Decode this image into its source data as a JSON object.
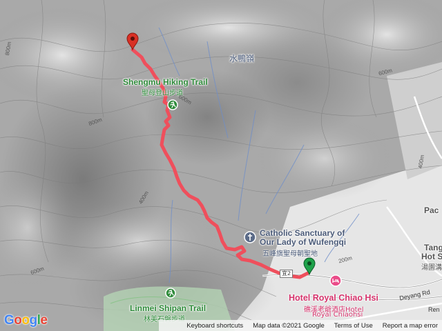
{
  "map": {
    "labels": {
      "shuiyaling": "水鴨嶺",
      "trail_start_en": "Shengmu Hiking Trail",
      "trail_start_zh": "聖母登山步道",
      "sanctuary_en_1": "Catholic Sanctuary of",
      "sanctuary_en_2": "Our Lady of Wufengqi",
      "sanctuary_zh": "五峰旗聖母朝聖地",
      "hotel_en": "Hotel Royal Chiao Hsi",
      "hotel_zh": "礁溪老爺酒店Hotel",
      "hotel_en_2": "Royal Chiaohsi",
      "linmei_en": "Linmei Shipan Trail",
      "linmei_zh": "林美石磐步道",
      "pac": "Pac",
      "tang": "Tang",
      "hot_s": "Hot S",
      "tang_zh": "湯園溝",
      "deyang": "Deyang Rd",
      "ren": "Ren",
      "route_shield": "宜2"
    },
    "contours": {
      "c800a": "800m",
      "c800b": "800m",
      "c600a": "600m",
      "c600b": "600m",
      "c400a": "400m",
      "c400b": "400m",
      "c200a": "200m",
      "c600c": "600m"
    },
    "colors": {
      "route": "#ef4f5c",
      "start_pin": "#1ea24a",
      "end_pin": "#d93025",
      "trail_icon": "#2e8b3a"
    },
    "icons": {
      "end_marker": "red-map-pin-icon",
      "start_marker": "green-map-pin-icon",
      "trailhead": "hiking-icon",
      "church": "church-icon",
      "hotel": "hotel-bed-icon"
    }
  },
  "footer": {
    "logo": [
      "G",
      "o",
      "o",
      "g",
      "l",
      "e"
    ],
    "keyboard": "Keyboard shortcuts",
    "mapdata": "Map data ©2021 Google",
    "terms": "Terms of Use",
    "report": "Report a map error"
  }
}
